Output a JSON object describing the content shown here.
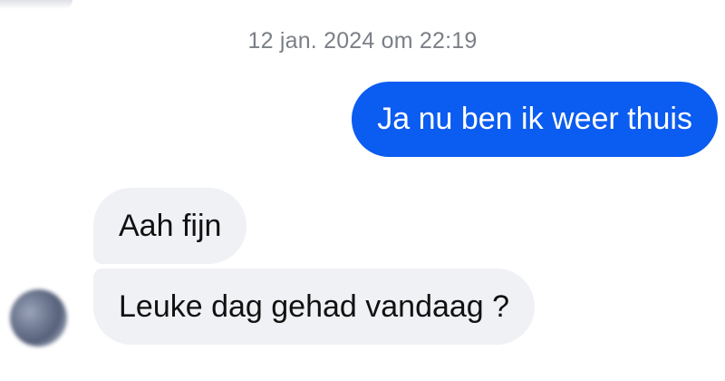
{
  "conversation": {
    "timestamp": "12 jan. 2024 om 22:19",
    "messages": [
      {
        "direction": "outgoing",
        "text": "Ja nu ben ik weer thuis"
      },
      {
        "direction": "incoming",
        "text": "Aah fijn"
      },
      {
        "direction": "incoming",
        "text": "Leuke dag gehad vandaag ?"
      }
    ]
  },
  "colors": {
    "outgoing_bubble": "#0b5cf0",
    "incoming_bubble": "#f0f1f4",
    "timestamp_text": "#7b7f86"
  },
  "icons": {
    "avatar": "contact-avatar-blurred"
  }
}
